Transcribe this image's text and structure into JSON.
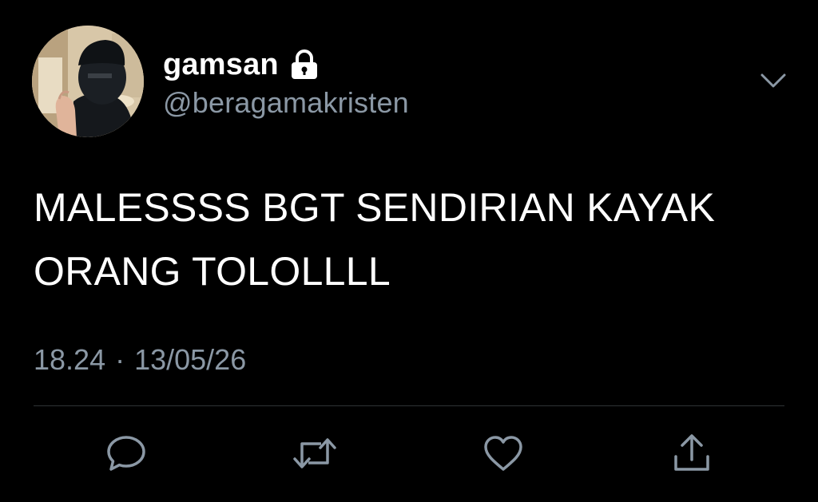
{
  "user": {
    "display_name": "gamsan",
    "handle": "@beragamakristen",
    "protected_icon": "lock-icon"
  },
  "tweet": {
    "text": "MALESSSS BGT SENDIRIAN KAYAK ORANG TOLOLLLL",
    "time": "18.24",
    "separator": "·",
    "date": "13/05/26"
  },
  "actions": [
    {
      "icon": "reply-icon"
    },
    {
      "icon": "retweet-icon"
    },
    {
      "icon": "like-icon"
    },
    {
      "icon": "share-icon"
    }
  ],
  "menu_icon": "chevron-down-icon",
  "colors": {
    "background": "#000000",
    "text": "#ffffff",
    "secondary": "#8b98a5",
    "divider": "#2f3336"
  }
}
